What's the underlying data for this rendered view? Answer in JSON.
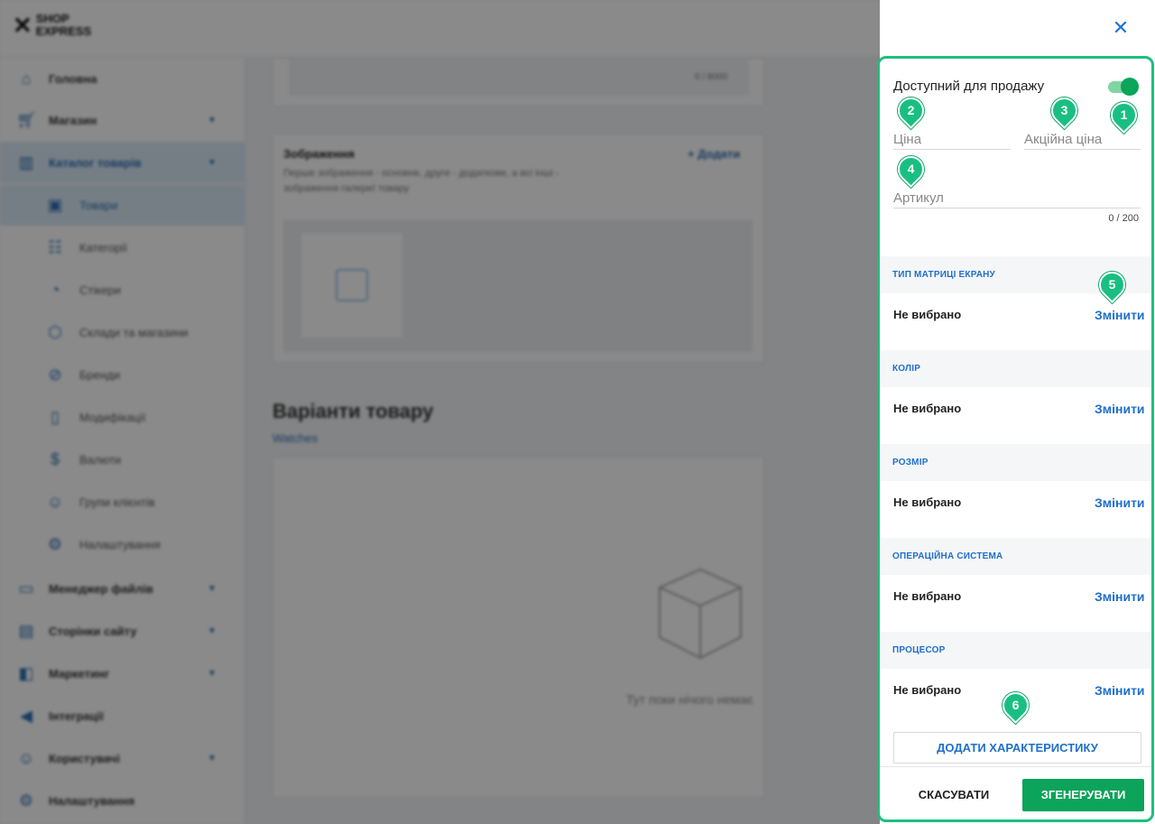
{
  "logo": {
    "text": "SHOP EXPRESS"
  },
  "sidebar": {
    "items": [
      {
        "label": "Головна",
        "icon": "home-icon"
      },
      {
        "label": "Магазин",
        "icon": "cart-icon"
      },
      {
        "label": "Каталог товарів",
        "icon": "book-icon"
      },
      {
        "label": "Товари",
        "icon": "box-icon"
      },
      {
        "label": "Категорії",
        "icon": "grid-list-icon"
      },
      {
        "label": "Стікери",
        "icon": "sticker-icon"
      },
      {
        "label": "Склади та магазини",
        "icon": "cube-icon"
      },
      {
        "label": "Бренди",
        "icon": "tag-icon"
      },
      {
        "label": "Модифікації",
        "icon": "bookmark-icon"
      },
      {
        "label": "Валюти",
        "icon": "dollar-icon"
      },
      {
        "label": "Групи клієнтів",
        "icon": "users-icon"
      },
      {
        "label": "Налаштування",
        "icon": "gear-icon"
      },
      {
        "label": "Менеджер файлів",
        "icon": "folder-icon"
      },
      {
        "label": "Сторінки сайту",
        "icon": "page-icon"
      },
      {
        "label": "Маркетинг",
        "icon": "marketing-icon"
      },
      {
        "label": "Інтеграції",
        "icon": "megaphone-icon"
      },
      {
        "label": "Користувачі",
        "icon": "user-icon"
      },
      {
        "label": "Налаштування",
        "icon": "gear-icon"
      }
    ]
  },
  "main": {
    "counter": "0 / 8000",
    "images": {
      "title": "Зображення",
      "description": "Перше зображення - основне, друге - додаткове, а всі інші - зображення галереї товару",
      "add_label": "Додати"
    },
    "variants": {
      "title": "Варіанти товару",
      "link": "Watches",
      "empty_text": "Тут поки нічого немає"
    }
  },
  "panel": {
    "available_label": "Доступний для продажу",
    "available_on": true,
    "price_placeholder": "Ціна",
    "sale_price_placeholder": "Акційна ціна",
    "sku_placeholder": "Артикул",
    "sku_counter": "0 / 200",
    "attributes": [
      {
        "heading": "ТИП МАТРИЦІ ЕКРАНУ",
        "value": "Не вибрано",
        "action": "Змінити"
      },
      {
        "heading": "КОЛІР",
        "value": "Не вибрано",
        "action": "Змінити"
      },
      {
        "heading": "РОЗМІР",
        "value": "Не вибрано",
        "action": "Змінити"
      },
      {
        "heading": "ОПЕРАЦІЙНА СИСТЕМА",
        "value": "Не вибрано",
        "action": "Змінити"
      },
      {
        "heading": "ПРОЦЕСОР",
        "value": "Не вибрано",
        "action": "Змінити"
      }
    ],
    "add_attribute_label": "ДОДАТИ ХАРАКТЕРИСТИКУ",
    "cancel_label": "СКАСУВАТИ",
    "generate_label": "ЗГЕНЕРУВАТИ",
    "close_icon": "close-icon"
  },
  "markers": [
    "1",
    "2",
    "3",
    "4",
    "5",
    "6"
  ],
  "colors": {
    "accent": "#1f6fcb",
    "green": "#0ca35a",
    "marker": "#19bf82"
  }
}
